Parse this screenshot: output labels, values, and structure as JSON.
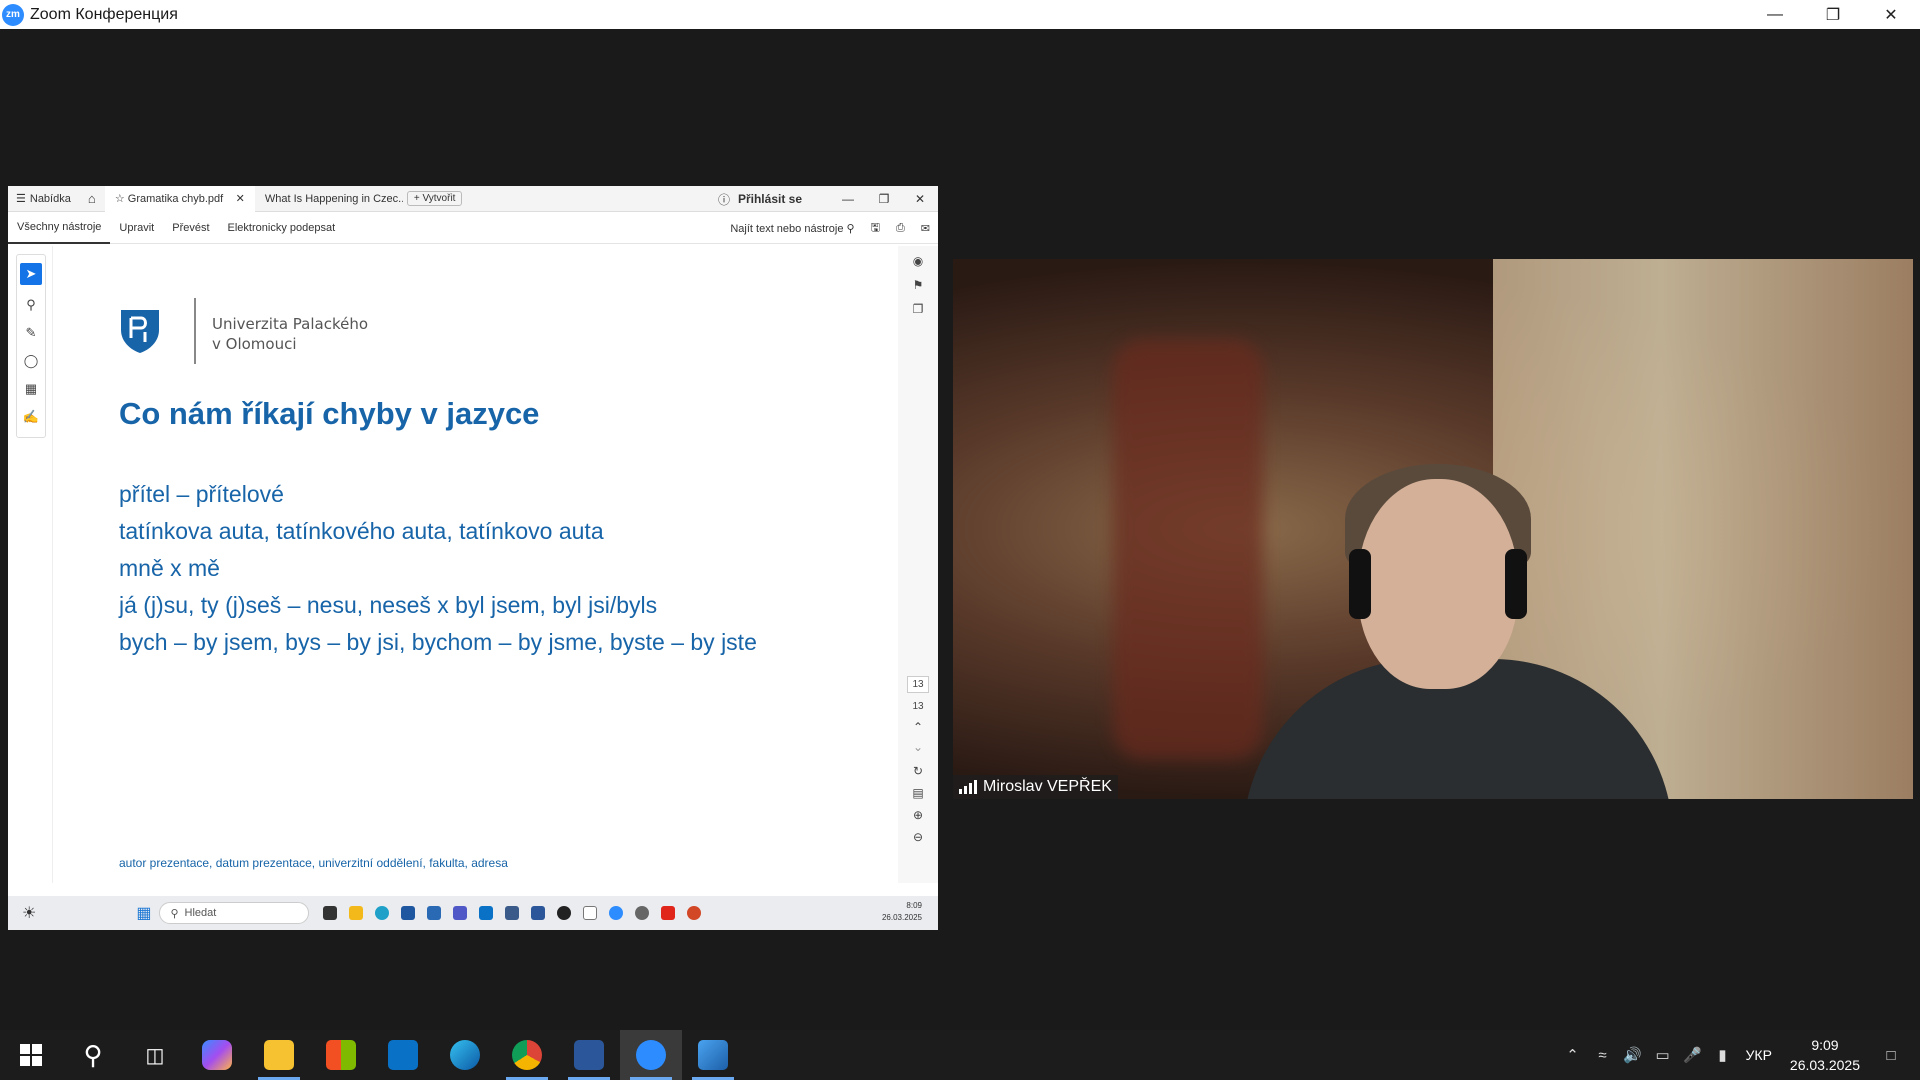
{
  "zoom": {
    "title": "Zoom Конференция",
    "logo": "zm"
  },
  "acrobat": {
    "menu_label": "Nabídka",
    "tab_active": "Gramatika chyb.pdf",
    "tab_other": "What Is Happening in Czec...",
    "new_tab": "+ Vytvořit",
    "sign_in": "Přihlásit se",
    "tools": [
      "Všechny nástroje",
      "Upravit",
      "Převést",
      "Elektronicky podepsat"
    ],
    "search_tools": "Najít text nebo nástroje",
    "page_current": "13",
    "page_total": "13"
  },
  "slide": {
    "uni_line1": "Univerzita Palackého",
    "uni_line2": "v Olomouci",
    "title": "Co nám říkají chyby v jazyce",
    "lines": [
      "přítel – přítelové",
      "tatínkova auta, tatínkového auta, tatínkovo auta",
      "mně x mě",
      "já (j)su, ty (j)seš – nesu, neseš x byl jsem, byl jsi/byls",
      "bych – by jsem, bys – by jsi, bychom – by jsme, byste – by jste"
    ],
    "footer": "autor prezentace, datum prezentace, univerzitní oddělení, fakulta, adresa"
  },
  "inner_taskbar": {
    "search_placeholder": "Hledat",
    "time": "8:09",
    "date": "26.03.2025"
  },
  "video": {
    "participant_name": "Miroslav VEPŘEK"
  },
  "taskbar": {
    "language": "УКР",
    "time": "9:09",
    "date": "26.03.2025",
    "apps": [
      "start-icon",
      "search-icon",
      "task-view-icon",
      "copilot-icon",
      "file-explorer-icon",
      "store-icon",
      "outlook-icon",
      "edge-icon",
      "chrome-icon",
      "word-icon",
      "zoom-icon",
      "photos-icon"
    ]
  }
}
